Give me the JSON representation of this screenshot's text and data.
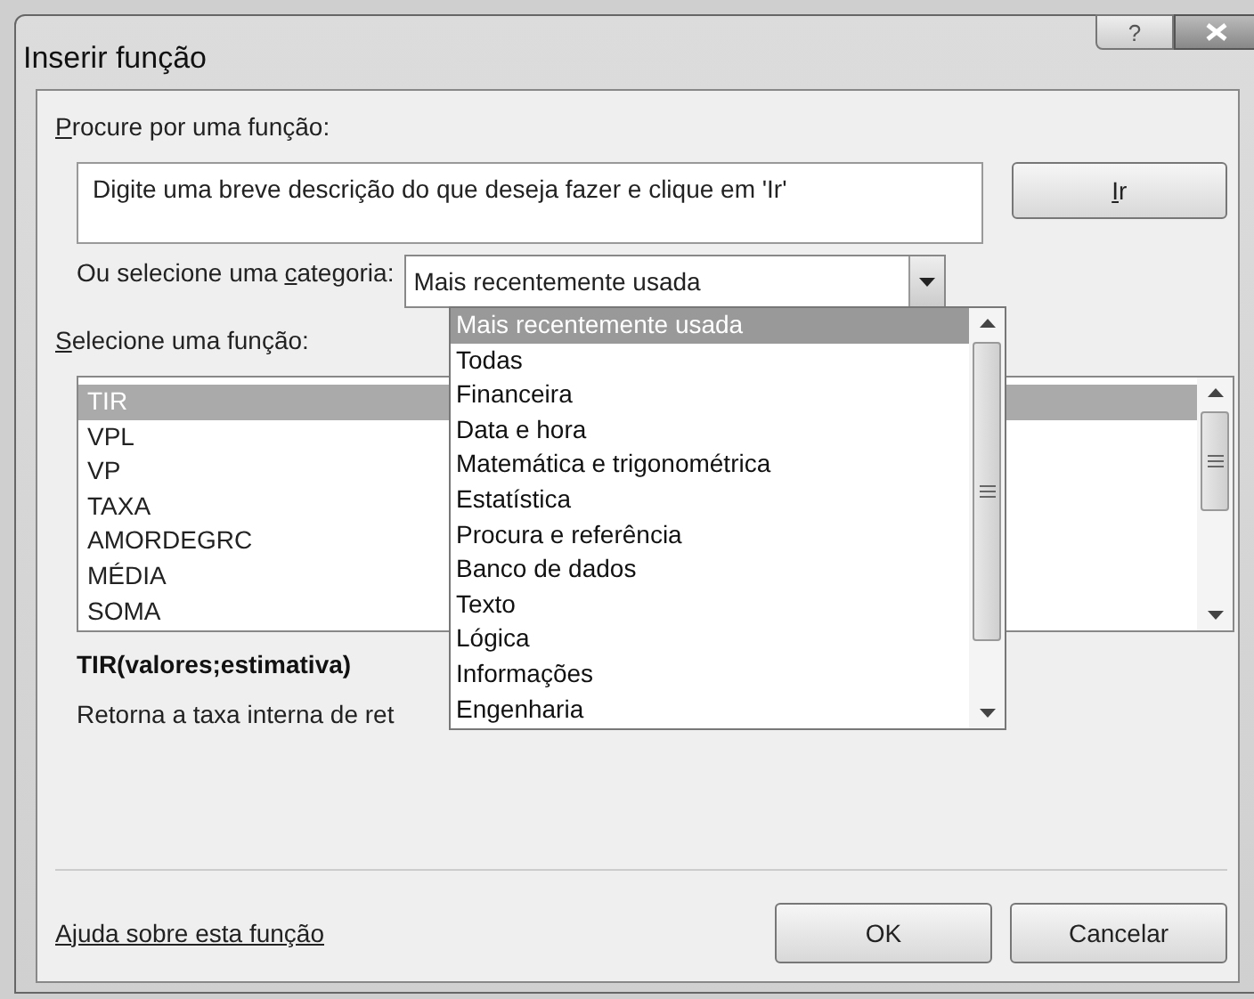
{
  "window": {
    "title": "Inserir função",
    "help": "?"
  },
  "search": {
    "label": {
      "key": "P",
      "after": "rocure por uma função:"
    },
    "value": "Digite uma breve descrição do que deseja fazer e clique em 'Ir'"
  },
  "go_button": {
    "key": "I",
    "after": "r"
  },
  "category": {
    "label": {
      "before": "Ou selecione uma ",
      "key": "c",
      "after": "ategoria:"
    },
    "value": "Mais recentemente usada",
    "expanded": true,
    "options": [
      {
        "label": "Mais recentemente usada",
        "selected": true
      },
      {
        "label": "Todas",
        "selected": false
      },
      {
        "label": "Financeira",
        "selected": false
      },
      {
        "label": "Data e hora",
        "selected": false
      },
      {
        "label": "Matemática e trigonométrica",
        "selected": false
      },
      {
        "label": "Estatística",
        "selected": false
      },
      {
        "label": "Procura e referência",
        "selected": false
      },
      {
        "label": "Banco de dados",
        "selected": false
      },
      {
        "label": "Texto",
        "selected": false
      },
      {
        "label": "Lógica",
        "selected": false
      },
      {
        "label": "Informações",
        "selected": false
      },
      {
        "label": "Engenharia",
        "selected": false
      }
    ]
  },
  "functions": {
    "label": {
      "key": "S",
      "after": "elecione uma função:"
    },
    "items": [
      {
        "label": "TIR",
        "selected": true
      },
      {
        "label": "VPL",
        "selected": false
      },
      {
        "label": "VP",
        "selected": false
      },
      {
        "label": "TAXA",
        "selected": false
      },
      {
        "label": "AMORDEGRC",
        "selected": false
      },
      {
        "label": "MÉDIA",
        "selected": false
      },
      {
        "label": "SOMA",
        "selected": false
      }
    ]
  },
  "signature": "TIR(valores;estimativa)",
  "description": "Retorna a taxa interna de ret",
  "help_link": "Ajuda sobre esta função",
  "buttons": [
    "OK",
    "Cancelar"
  ]
}
